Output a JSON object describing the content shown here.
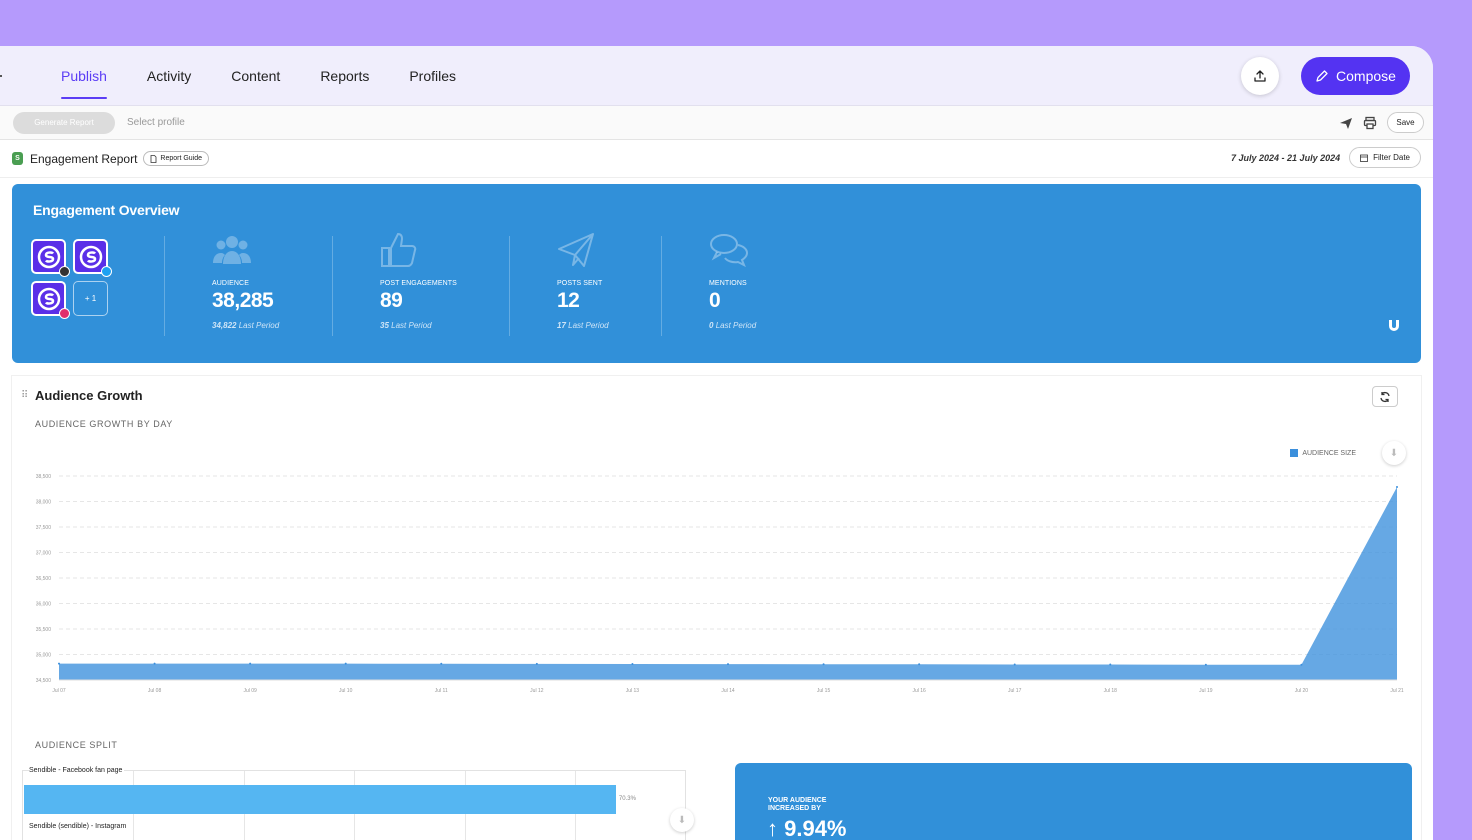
{
  "nav": {
    "tabs": [
      {
        "label": "Publish"
      },
      {
        "label": "Activity"
      },
      {
        "label": "Content"
      },
      {
        "label": "Reports"
      },
      {
        "label": "Profiles"
      }
    ],
    "compose_label": "Compose"
  },
  "toolbar": {
    "generate_label": "Generate Report",
    "select_profile": "Select profile",
    "save_label": "Save"
  },
  "report": {
    "badge": "S",
    "title": "Engagement Report",
    "guide_label": "Report Guide",
    "date_range": "7 July 2024 - 21 July 2024",
    "filter_label": "Filter Date"
  },
  "overview": {
    "title": "Engagement Overview",
    "extra_profiles": "+ 1",
    "stats": [
      {
        "label": "AUDIENCE",
        "value": "38,285",
        "last_value": "34,822",
        "last_label": "Last Period",
        "icon": "users-icon"
      },
      {
        "label": "POST ENGAGEMENTS",
        "value": "89",
        "last_value": "35",
        "last_label": "Last Period",
        "icon": "thumbs-up-icon"
      },
      {
        "label": "POSTS SENT",
        "value": "12",
        "last_value": "17",
        "last_label": "Last Period",
        "icon": "paper-plane-icon"
      },
      {
        "label": "MENTIONS",
        "value": "0",
        "last_value": "0",
        "last_label": "Last Period",
        "icon": "chat-bubbles-icon"
      }
    ],
    "colors": {
      "card": "#3190d9",
      "profile": "#5a2fe8"
    }
  },
  "growth": {
    "title": "Audience Growth",
    "subtitle": "AUDIENCE GROWTH BY DAY",
    "legend": "AUDIENCE SIZE"
  },
  "chart_data": {
    "type": "area",
    "x": [
      "Jul 07",
      "Jul 08",
      "Jul 09",
      "Jul 10",
      "Jul 11",
      "Jul 12",
      "Jul 13",
      "Jul 14",
      "Jul 15",
      "Jul 16",
      "Jul 17",
      "Jul 18",
      "Jul 19",
      "Jul 20",
      "Jul 21"
    ],
    "series": [
      {
        "name": "AUDIENCE SIZE",
        "values": [
          34822,
          34822,
          34820,
          34820,
          34818,
          34816,
          34814,
          34812,
          34810,
          34808,
          34805,
          34803,
          34800,
          34800,
          38285
        ]
      }
    ],
    "yticks": [
      "38,500",
      "38,000",
      "37,500",
      "37,000",
      "36,500",
      "36,000",
      "35,500",
      "35,000",
      "34,500"
    ],
    "ylim": [
      34500,
      38500
    ],
    "grid": true,
    "legend_position": "top-right",
    "color": "#3b8fdc"
  },
  "split": {
    "title": "AUDIENCE SPLIT",
    "bars": [
      {
        "label": "Sendible - Facebook fan page",
        "value": 70.3,
        "pct": "70.3%"
      },
      {
        "label": "Sendible (sendible) - Instagram"
      }
    ]
  },
  "increase": {
    "label": "YOUR AUDIENCE INCREASED BY",
    "value": "↑ 9.94%"
  }
}
